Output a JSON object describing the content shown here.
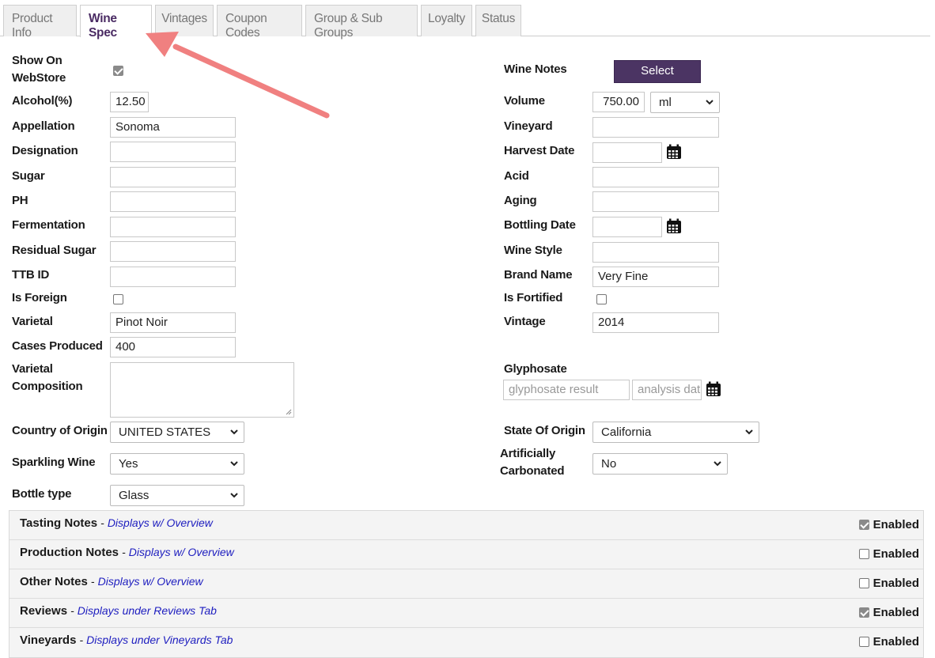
{
  "tabs": [
    "Product Info",
    "Wine Spec",
    "Vintages",
    "Coupon Codes",
    "Group & Sub Groups",
    "Loyalty",
    "Status"
  ],
  "left": {
    "show_on_webstore_label_1": "Show On",
    "show_on_webstore_label_2": "WebStore",
    "alcohol_label": "Alcohol(%)",
    "alcohol_value": "12.50",
    "appellation_label": "Appellation",
    "appellation_value": "Sonoma",
    "designation_label": "Designation",
    "sugar_label": "Sugar",
    "ph_label": "PH",
    "fermentation_label": "Fermentation",
    "residual_sugar_label": "Residual Sugar",
    "ttb_id_label": "TTB ID",
    "is_foreign_label": "Is Foreign",
    "varietal_label": "Varietal",
    "varietal_value": "Pinot Noir",
    "cases_produced_label": "Cases Produced",
    "cases_produced_value": "400",
    "varietal_composition_label_1": "Varietal",
    "varietal_composition_label_2": "Composition",
    "country_of_origin_label": "Country of Origin",
    "country_of_origin_value": "UNITED STATES",
    "sparkling_wine_label": "Sparkling Wine",
    "sparkling_wine_value": "Yes",
    "bottle_type_label": "Bottle type",
    "bottle_type_value": "Glass"
  },
  "right": {
    "wine_notes_label": "Wine Notes",
    "select_button": "Select",
    "volume_label": "Volume",
    "volume_value": "750.00",
    "volume_unit": "ml",
    "vineyard_label": "Vineyard",
    "harvest_date_label": "Harvest Date",
    "acid_label": "Acid",
    "aging_label": "Aging",
    "bottling_date_label": "Bottling Date",
    "wine_style_label": "Wine Style",
    "brand_name_label": "Brand Name",
    "brand_name_value": "Very Fine",
    "is_fortified_label": "Is Fortified",
    "vintage_label": "Vintage",
    "vintage_value": "2014",
    "glyphosate_label": "Glyphosate",
    "glyphosate_result_placeholder": "glyphosate result",
    "analysis_date_placeholder": "analysis date",
    "state_of_origin_label": "State Of Origin",
    "state_of_origin_value": "California",
    "artificially_carbonated_label_1": "Artificially",
    "artificially_carbonated_label_2": "Carbonated",
    "artificially_carbonated_value": "No"
  },
  "notes": [
    {
      "title": "Tasting Notes",
      "sub": "Displays w/ Overview",
      "enabled_label": "Enabled"
    },
    {
      "title": "Production Notes",
      "sub": "Displays w/ Overview",
      "enabled_label": "Enabled"
    },
    {
      "title": "Other Notes",
      "sub": "Displays w/ Overview",
      "enabled_label": "Enabled"
    },
    {
      "title": "Reviews",
      "sub": "Displays under Reviews Tab",
      "enabled_label": "Enabled"
    },
    {
      "title": "Vineyards",
      "sub": "Displays under Vineyards Tab",
      "enabled_label": "Enabled"
    }
  ],
  "checkboxes": {
    "show_on_webstore": true,
    "is_foreign": false,
    "is_fortified": false,
    "tasting_notes_enabled": true,
    "production_notes_enabled": false,
    "other_notes_enabled": false,
    "reviews_enabled": true,
    "vineyards_enabled": false
  },
  "colors": {
    "accent": "#4b3463",
    "arrow": "#f08080",
    "link": "#1d1dbf"
  },
  "icons": {
    "calendar": "calendar-icon",
    "dropdown": "chevron-down-icon"
  }
}
